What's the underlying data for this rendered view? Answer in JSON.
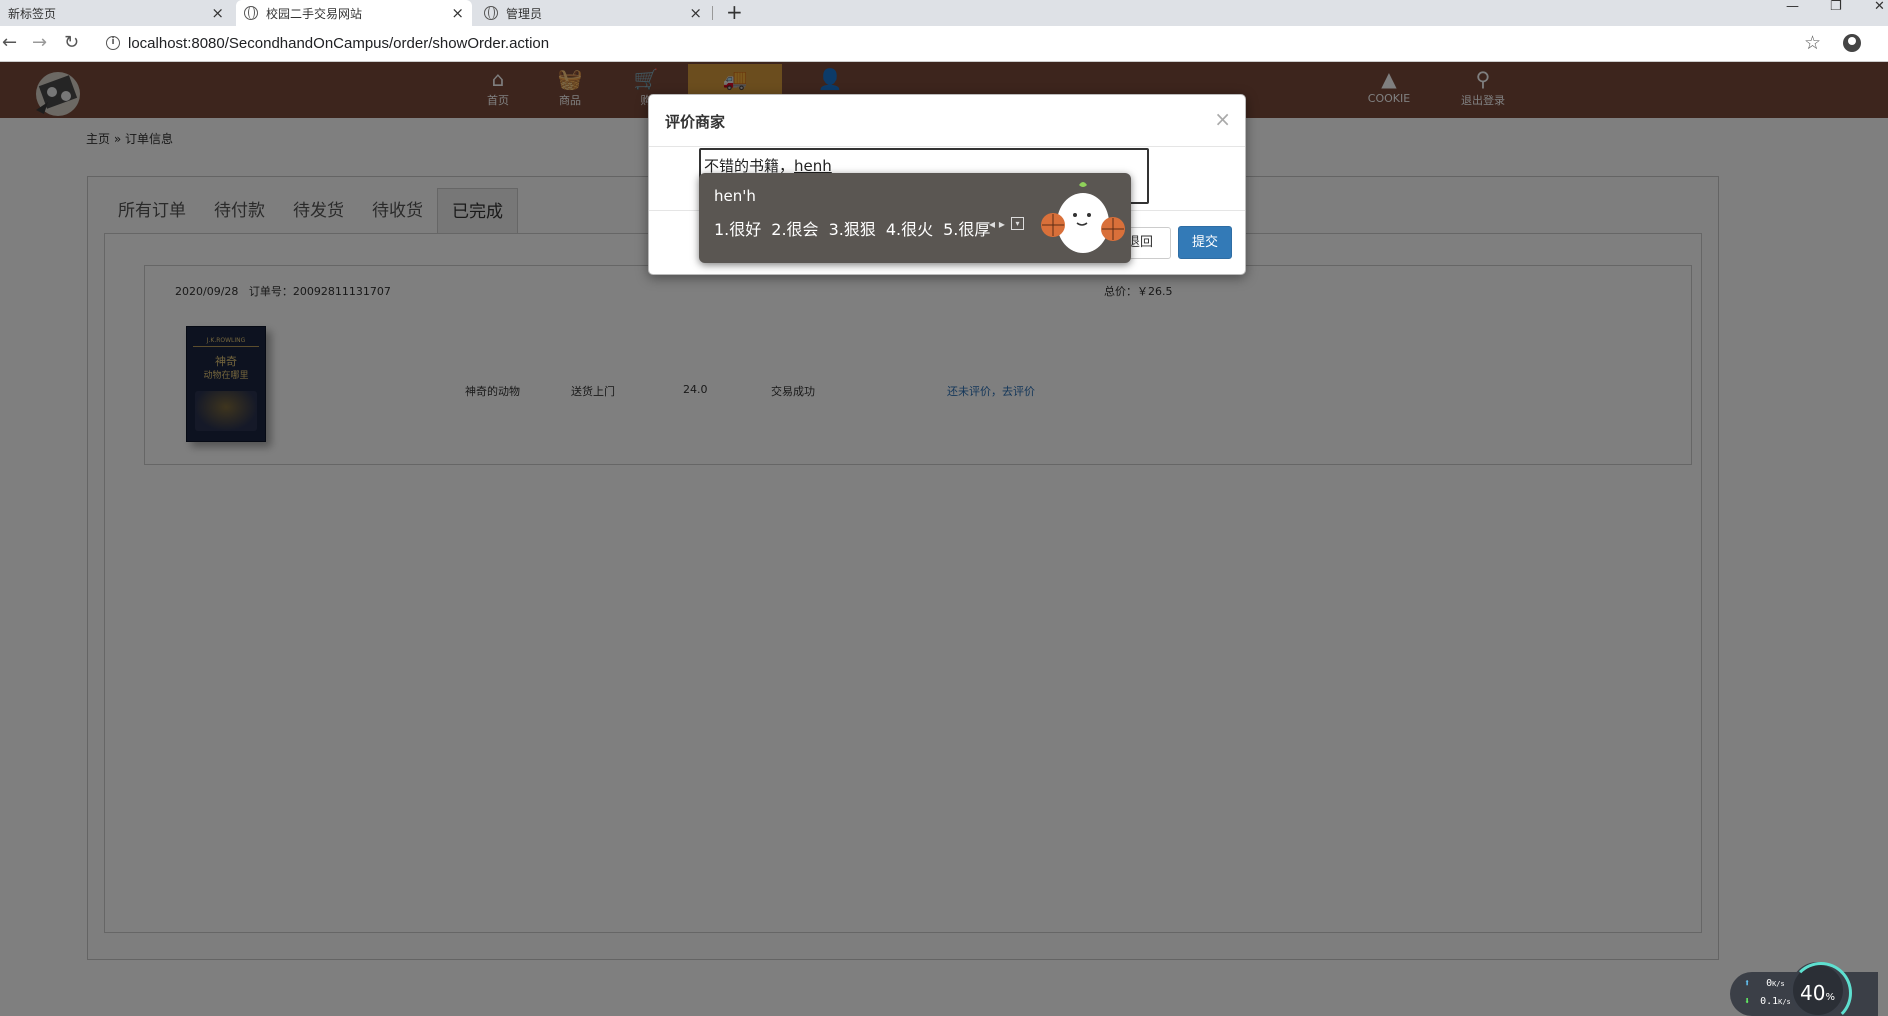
{
  "browser": {
    "tabs": [
      {
        "title": "新标签页",
        "active": false
      },
      {
        "title": "校园二手交易网站",
        "active": true
      },
      {
        "title": "管理员",
        "active": false
      }
    ],
    "new_tab": "+",
    "url": "localhost:8080/SecondhandOnCampus/order/showOrder.action"
  },
  "site": {
    "nav": [
      {
        "label": "首页",
        "icon": "home-icon"
      },
      {
        "label": "商品",
        "icon": "basket-icon"
      },
      {
        "label": "购",
        "icon": "cart-icon"
      },
      {
        "label": "",
        "icon": "truck-icon",
        "active": true
      },
      {
        "label": "",
        "icon": "user-settings-icon"
      }
    ],
    "nav_right": [
      {
        "label": "COOKIE",
        "icon": "cookie-icon"
      },
      {
        "label": "退出登录",
        "icon": "logout-icon"
      }
    ]
  },
  "breadcrumb": {
    "home": "主页",
    "sep": "»",
    "current": "订单信息"
  },
  "order_tabs": [
    {
      "label": "所有订单",
      "active": false
    },
    {
      "label": "待付款",
      "active": false
    },
    {
      "label": "待发货",
      "active": false
    },
    {
      "label": "待收货",
      "active": false
    },
    {
      "label": "已完成",
      "active": true
    }
  ],
  "order": {
    "date": "2020/09/28",
    "order_no_label": "订单号：",
    "order_no": "20092811131707",
    "total_label": "总价：",
    "total": "￥26.5",
    "product_name": "神奇的动物",
    "delivery": "送货上门",
    "price": "24.0",
    "status": "交易成功",
    "review_link": "还未评价，去评价",
    "book_cover": {
      "author": "J.K.ROWLING",
      "title_line1": "神奇",
      "title_line2": "动物在哪里"
    }
  },
  "modal": {
    "title": "评价商家",
    "close": "×",
    "review_text_committed": "不错的书籍，",
    "review_text_composing": "henh",
    "back_button": "退回",
    "submit_button": "提交"
  },
  "ime": {
    "composition": "hen'h",
    "candidates": [
      "1.很好",
      "2.很会",
      "3.狠狠",
      "4.很火",
      "5.很厚"
    ],
    "arrows": "◂ ▸",
    "expand": "▾"
  },
  "net_speed": {
    "up": "0",
    "up_unit": "K/s",
    "down": "0.1",
    "down_unit": "K/s",
    "percent": "40",
    "percent_unit": "%"
  }
}
